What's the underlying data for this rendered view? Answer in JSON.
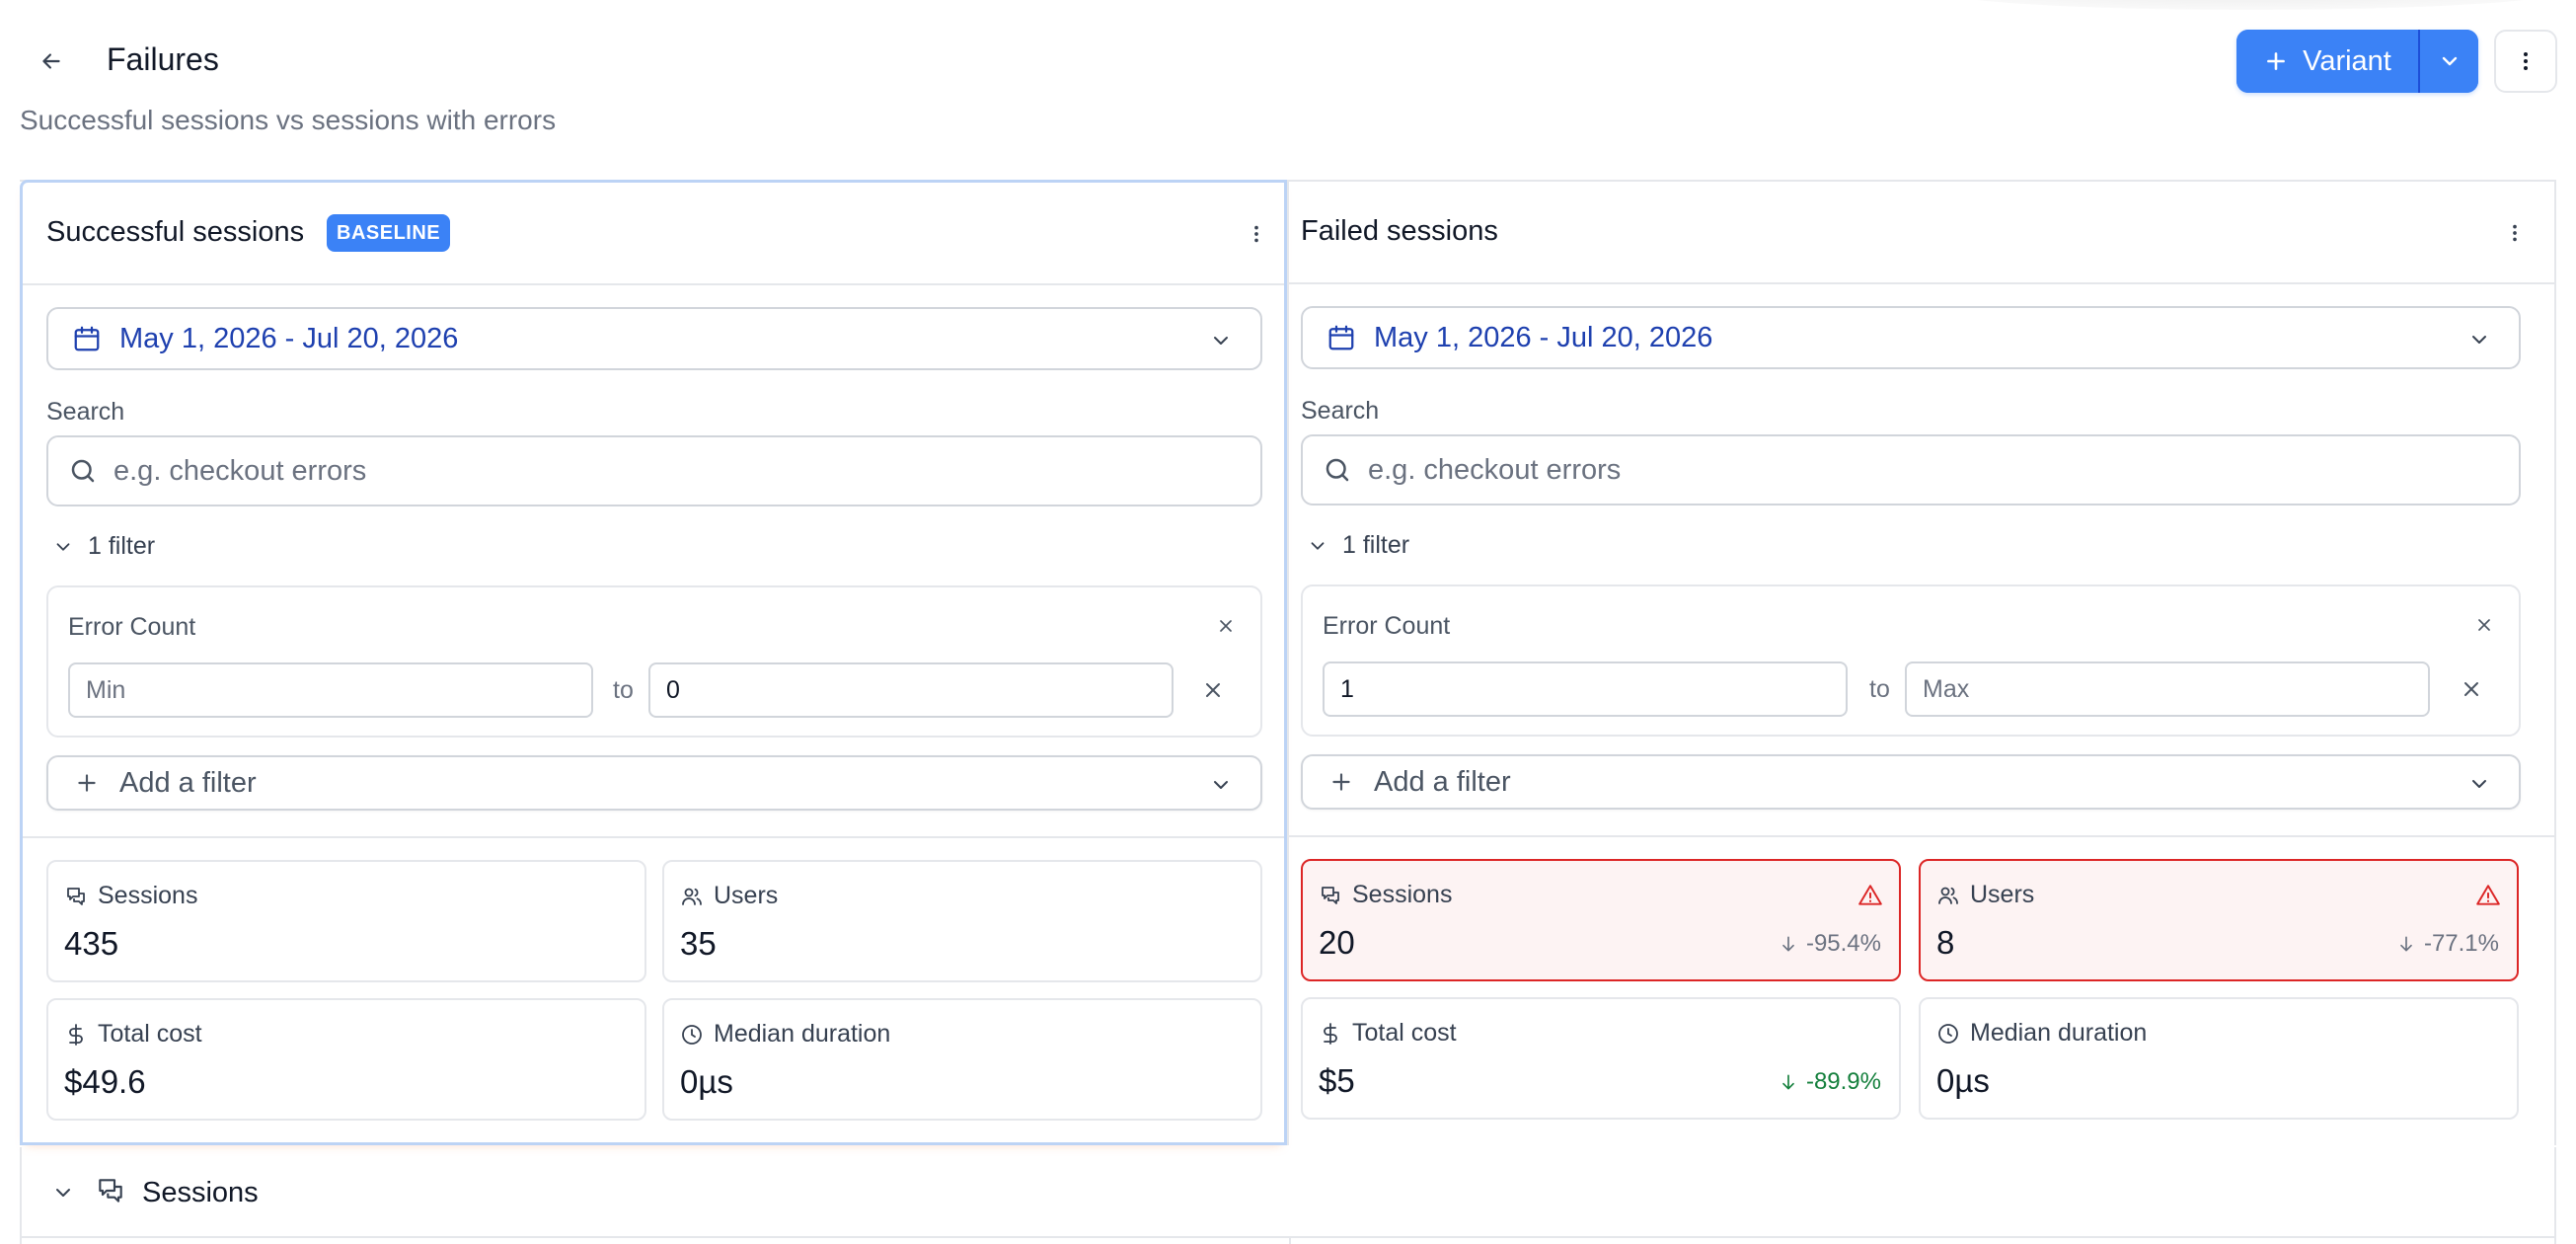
{
  "header": {
    "title": "Failures",
    "subtitle": "Successful sessions vs sessions with errors",
    "variant_label": "Variant"
  },
  "panels": [
    {
      "title": "Successful sessions",
      "badge": "BASELINE",
      "date_range": "May 1, 2026 - Jul 20, 2026",
      "search_label": "Search",
      "search_placeholder": "e.g. checkout errors",
      "filter_toggle": "1 filter",
      "filter": {
        "name": "Error Count",
        "min_placeholder": "Min",
        "min_value": "",
        "to_label": "to",
        "max_placeholder": "Max",
        "max_value": "0"
      },
      "add_filter_label": "Add a filter",
      "metrics": {
        "sessions": {
          "label": "Sessions",
          "value": "435"
        },
        "users": {
          "label": "Users",
          "value": "35"
        },
        "total_cost": {
          "label": "Total cost",
          "value": "$49.6"
        },
        "median_duration": {
          "label": "Median duration",
          "value": "0µs"
        }
      }
    },
    {
      "title": "Failed sessions",
      "date_range": "May 1, 2026 - Jul 20, 2026",
      "search_label": "Search",
      "search_placeholder": "e.g. checkout errors",
      "filter_toggle": "1 filter",
      "filter": {
        "name": "Error Count",
        "min_placeholder": "Min",
        "min_value": "1",
        "to_label": "to",
        "max_placeholder": "Max",
        "max_value": ""
      },
      "add_filter_label": "Add a filter",
      "metrics": {
        "sessions": {
          "label": "Sessions",
          "value": "20",
          "delta": "-95.4%"
        },
        "users": {
          "label": "Users",
          "value": "8",
          "delta": "-77.1%"
        },
        "total_cost": {
          "label": "Total cost",
          "value": "$5",
          "delta": "-89.9%"
        },
        "median_duration": {
          "label": "Median duration",
          "value": "0µs"
        }
      }
    }
  ],
  "sessions_section": {
    "title": "Sessions"
  },
  "colors": {
    "accent": "#3b82f6",
    "date_text": "#1e40af",
    "alert_border": "#dc2626",
    "alert_bg": "#fdf3f3",
    "positive": "#15803d"
  },
  "icons": {
    "back": "arrow-left-icon",
    "plus": "plus-icon",
    "chevron": "chevron-down-icon",
    "more": "more-vertical-icon",
    "calendar": "calendar-icon",
    "search": "search-icon",
    "close": "close-icon",
    "sessions": "chat-bubbles-icon",
    "users": "users-icon",
    "cost": "dollar-icon",
    "duration": "clock-icon",
    "warning": "warning-triangle-icon",
    "down": "arrow-down-icon"
  }
}
